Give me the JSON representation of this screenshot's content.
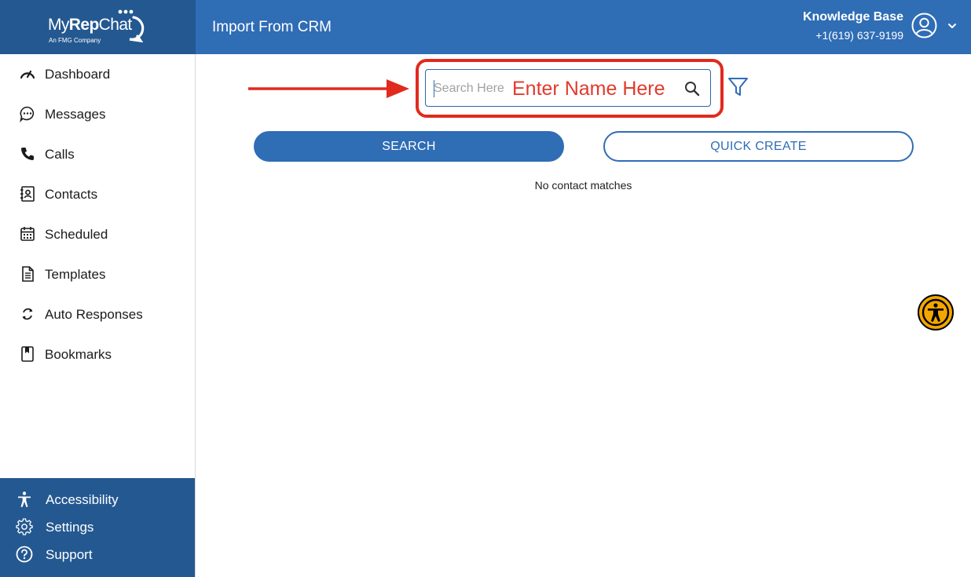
{
  "brand": {
    "name_light": "My",
    "name_bold": "Rep",
    "name_end": "Chat",
    "tagline": "An FMG Company"
  },
  "colors": {
    "primary_dark": "#245891",
    "primary": "#2f6db5",
    "annotation_red": "#e12a1e",
    "accessibility_yellow": "#f3a600"
  },
  "sidebar": {
    "items": [
      {
        "label": "Dashboard",
        "icon": "speedometer-icon"
      },
      {
        "label": "Messages",
        "icon": "chat-bubble-icon"
      },
      {
        "label": "Calls",
        "icon": "phone-icon"
      },
      {
        "label": "Contacts",
        "icon": "contact-card-icon"
      },
      {
        "label": "Scheduled",
        "icon": "calendar-icon"
      },
      {
        "label": "Templates",
        "icon": "document-icon"
      },
      {
        "label": "Auto Responses",
        "icon": "refresh-icon"
      },
      {
        "label": "Bookmarks",
        "icon": "bookmark-icon"
      }
    ],
    "bottom": [
      {
        "label": "Accessibility",
        "icon": "accessibility-icon"
      },
      {
        "label": "Settings",
        "icon": "gear-icon"
      },
      {
        "label": "Support",
        "icon": "help-circle-icon"
      }
    ]
  },
  "header": {
    "title": "Import From CRM",
    "account_name": "Knowledge Base",
    "phone": "+1(619) 637-9199"
  },
  "search": {
    "placeholder": "Search Here",
    "value": "",
    "annotation": "Enter Name Here"
  },
  "buttons": {
    "search": "SEARCH",
    "quick_create": "QUICK CREATE"
  },
  "results": {
    "empty_message": "No contact matches"
  }
}
